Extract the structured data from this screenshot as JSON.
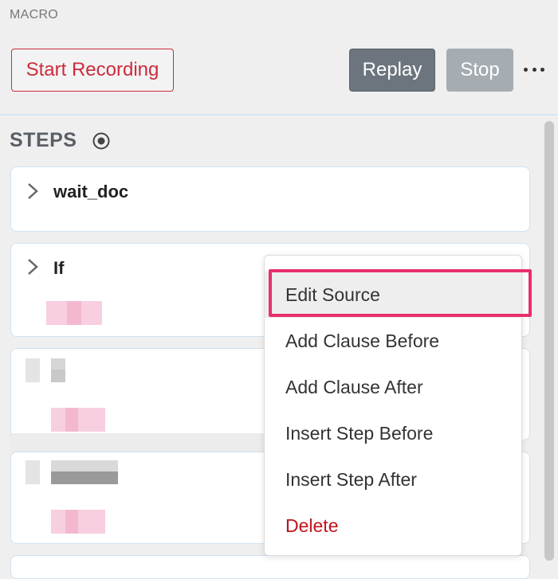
{
  "macro": {
    "section_label": "MACRO"
  },
  "toolbar": {
    "start_recording_label": "Start Recording",
    "replay_label": "Replay",
    "stop_label": "Stop",
    "more_icon": "more-horizontal-icon"
  },
  "steps": {
    "title": "STEPS",
    "title_icon": "target-icon",
    "items": [
      {
        "name": "wait_doc",
        "icon": "chevron-right-icon"
      },
      {
        "name": "If",
        "icon": "chevron-right-icon"
      }
    ]
  },
  "context_menu": {
    "items": [
      {
        "label": "Edit Source",
        "highlighted": true
      },
      {
        "label": "Add Clause Before"
      },
      {
        "label": "Add Clause After"
      },
      {
        "label": "Insert Step Before"
      },
      {
        "label": "Insert Step After"
      },
      {
        "label": "Delete",
        "danger": true
      }
    ]
  },
  "colors": {
    "record": "#cc2b3b",
    "replay": "#6c757d",
    "stop": "#a5acb2",
    "highlight": "#e8306b",
    "delete": "#c0141c",
    "card_border": "#d0e2f2"
  }
}
